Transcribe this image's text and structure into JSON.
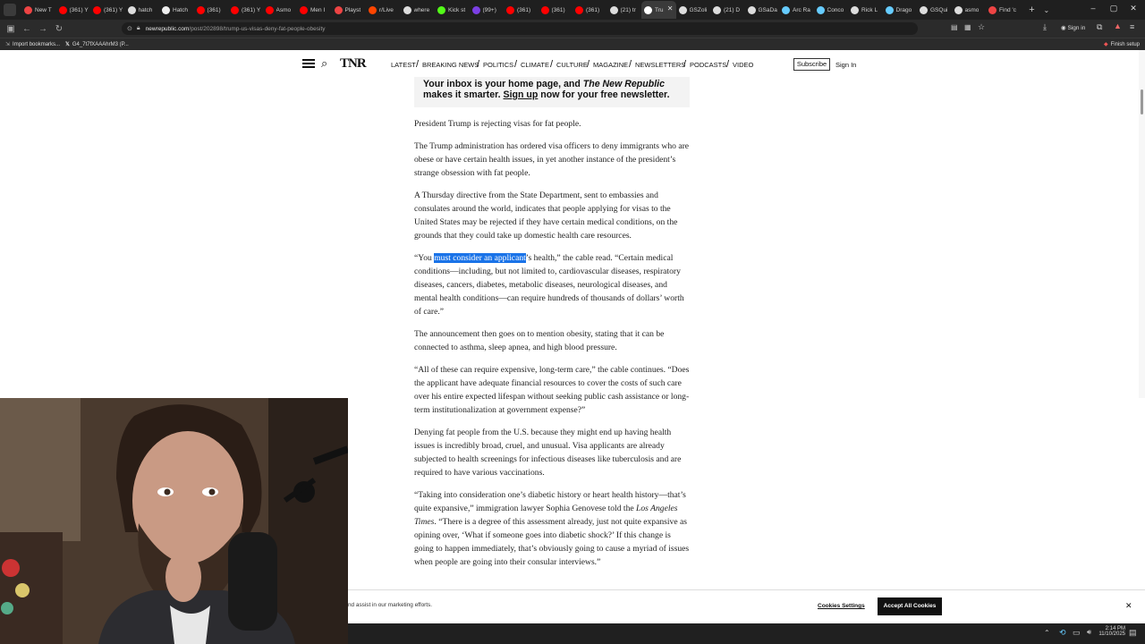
{
  "browser": {
    "tabs": [
      {
        "title": "New T",
        "color": "#e44"
      },
      {
        "title": "(361) Y",
        "color": "#f00"
      },
      {
        "title": "(361) Y",
        "color": "#f00"
      },
      {
        "title": "hatch",
        "color": "#ddd"
      },
      {
        "title": "Hatch",
        "color": "#eee"
      },
      {
        "title": "(361)",
        "color": "#f00"
      },
      {
        "title": "(361) Y",
        "color": "#f00"
      },
      {
        "title": "Asmo",
        "color": "#f00"
      },
      {
        "title": "Men I",
        "color": "#f00"
      },
      {
        "title": "Playst",
        "color": "#e44"
      },
      {
        "title": "r/Live",
        "color": "#ff4500"
      },
      {
        "title": "where",
        "color": "#ddd"
      },
      {
        "title": "Kick st",
        "color": "#53fc18"
      },
      {
        "title": "(99+)",
        "color": "#7b3fe4"
      },
      {
        "title": "(361)",
        "color": "#f00"
      },
      {
        "title": "(361)",
        "color": "#f00"
      },
      {
        "title": "(361)",
        "color": "#f00"
      },
      {
        "title": "(21) tr",
        "color": "#ddd"
      },
      {
        "title": "Tru",
        "color": "#fff",
        "active": true
      },
      {
        "title": "GSZoli",
        "color": "#ddd"
      },
      {
        "title": "(21) D",
        "color": "#ddd"
      },
      {
        "title": "GSaDa",
        "color": "#ddd"
      },
      {
        "title": "Arc Ra",
        "color": "#6cf"
      },
      {
        "title": "Conco",
        "color": "#6cf"
      },
      {
        "title": "Rick L",
        "color": "#ddd"
      },
      {
        "title": "Drago",
        "color": "#6cf"
      },
      {
        "title": "GSQui",
        "color": "#ddd"
      },
      {
        "title": "asmo",
        "color": "#ddd"
      },
      {
        "title": "Find 'c",
        "color": "#e44"
      }
    ],
    "new_tab": "+",
    "tab_menu": "⌄",
    "url_domain": "newrepublic.com",
    "url_path": "/post/202898/trump-us-visas-deny-fat-people-obesity",
    "sign_in": "Sign in",
    "finish_setup": "Finish setup",
    "bookmarks": [
      "Import bookmarks...",
      "G4_7t7fXAAAhrM3 (P..."
    ]
  },
  "site": {
    "logo": "TNR",
    "nav": [
      "LATEST",
      "BREAKING NEWS",
      "POLITICS",
      "CLIMATE",
      "CULTURE",
      "MAGAZINE",
      "NEWSLETTERS",
      "PODCASTS",
      "VIDEO"
    ],
    "subscribe": "Subscribe",
    "sign_in": "Sign In"
  },
  "promo": {
    "line1a": "Your inbox is your home page, and ",
    "line1b": "The New Republic",
    "line2a": "makes it smarter. ",
    "line2b": "Sign up",
    "line2c": " now for your free newsletter."
  },
  "article": {
    "p1": "President Trump is rejecting visas for fat people.",
    "p2": "The Trump administration has ordered visa officers to deny immigrants who are obese or have certain health issues, in yet another instance of the president’s strange obsession with fat people.",
    "p3": "A Thursday directive from the State Department, sent to embassies and consulates around the world, indicates that people applying for visas to the United States may be rejected if they have certain medical conditions, on the grounds that they could take up domestic health care resources.",
    "p4_pre": "“You ",
    "p4_hl": "must consider an applicant",
    "p4_post": "’s health,” the cable read. “Certain medical conditions—including, but not limited to, cardiovascular diseases, respiratory diseases, cancers, diabetes, metabolic diseases, neurological diseases, and mental health conditions—can require hundreds of thousands of dollars’ worth of care.”",
    "p5": "The announcement then goes on to mention obesity, stating that it can be connected to asthma, sleep apnea, and high blood pressure.",
    "p6": "“All of these can require expensive, long-term care,” the cable continues. “Does the applicant have adequate financial resources to cover the costs of such care over his entire expected lifespan without seeking public cash assistance or long-term institutionalization at government expense?”",
    "p7": "Denying fat people from the U.S. because they might end up having health issues is incredibly broad, cruel, and unusual. Visa applicants are already subjected to health screenings for infectious diseases like tuberculosis and are required to have various vaccinations.",
    "p8a": "“Taking into consideration one’s diabetic history or heart health history—that’s quite expansive,” immigration lawyer Sophia Genovese told the ",
    "p8b": "Los Angeles Times",
    "p8c": ". “There is a degree of this assessment already, just not quite expansive as opining over, ‘What if someone goes into diabetic shock?’ If this change is going to happen immediately, that’s obviously going to cause a myriad of issues when people are going into their consular interviews.”"
  },
  "cookie": {
    "text": "nd assist in our marketing efforts.",
    "settings": "Cookies Settings",
    "accept": "Accept All Cookies",
    "close": "✕"
  },
  "taskbar": {
    "time": "2:14 PM",
    "date": "11/10/2025"
  },
  "colors": {
    "highlight": "#1a73e8",
    "browser_dark": "#1f1f1f",
    "accept_btn": "#111111"
  }
}
